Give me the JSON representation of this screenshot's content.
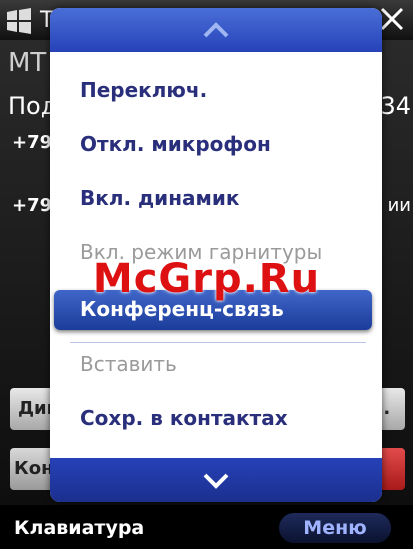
{
  "titlebar": {
    "title_char": "T"
  },
  "background": {
    "operator": "МТ",
    "status_left": "Под",
    "status_right": "34",
    "number1": "+79",
    "number2": "+79",
    "right_fragment": "ии",
    "btn_left1": "Дин",
    "btn_right1": "н.",
    "btn_left2": "Конф"
  },
  "menu": {
    "items": [
      {
        "label": "Переключ.",
        "enabled": true
      },
      {
        "label": "Откл. микрофон",
        "enabled": true
      },
      {
        "label": "Вкл. динамик",
        "enabled": true
      },
      {
        "label": "Вкл. режим гарнитуры",
        "enabled": false
      },
      {
        "label": "Конференц-связь",
        "enabled": true,
        "selected": true
      },
      {
        "label": "Вставить",
        "enabled": false
      },
      {
        "label": "Сохр. в контактах",
        "enabled": true
      }
    ],
    "scroll_up_icon": "chevron-up-icon",
    "scroll_down_icon": "chevron-down-icon"
  },
  "softkeys": {
    "left": "Клавиатура",
    "right": "Меню"
  },
  "watermark": "McGrp.Ru",
  "colors": {
    "menu_text": "#2a2f7c",
    "accent": "#2642b8",
    "disabled": "#9a9a9a",
    "end_call": "#c92a2a"
  }
}
